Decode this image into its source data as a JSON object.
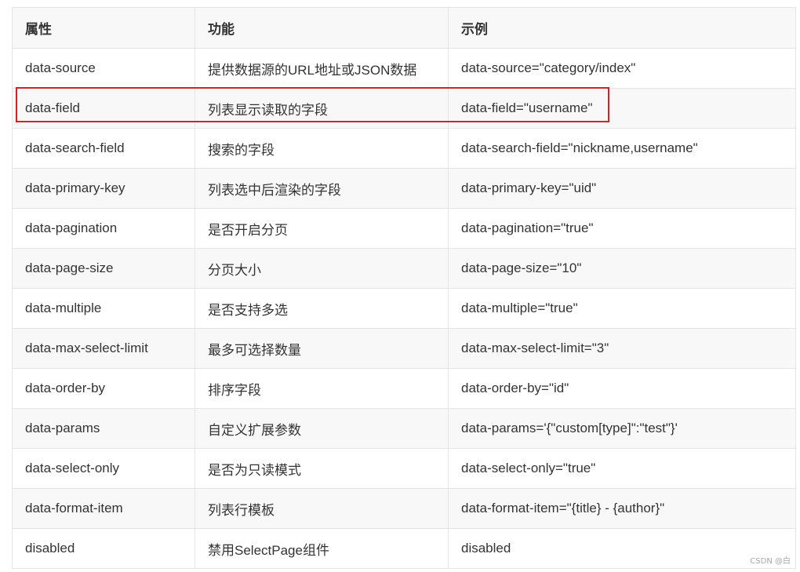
{
  "table": {
    "headers": [
      "属性",
      "功能",
      "示例"
    ],
    "rows": [
      [
        "data-source",
        "提供数据源的URL地址或JSON数据",
        "data-source=\"category/index\""
      ],
      [
        "data-field",
        "列表显示读取的字段",
        "data-field=\"username\""
      ],
      [
        "data-search-field",
        "搜索的字段",
        "data-search-field=\"nickname,username\""
      ],
      [
        "data-primary-key",
        "列表选中后渲染的字段",
        "data-primary-key=\"uid\""
      ],
      [
        "data-pagination",
        "是否开启分页",
        "data-pagination=\"true\""
      ],
      [
        "data-page-size",
        "分页大小",
        "data-page-size=\"10\""
      ],
      [
        "data-multiple",
        "是否支持多选",
        "data-multiple=\"true\""
      ],
      [
        "data-max-select-limit",
        "最多可选择数量",
        "data-max-select-limit=\"3\""
      ],
      [
        "data-order-by",
        "排序字段",
        "data-order-by=\"id\""
      ],
      [
        "data-params",
        "自定义扩展参数",
        "data-params='{\"custom[type]\":\"test\"}'"
      ],
      [
        "data-select-only",
        "是否为只读模式",
        "data-select-only=\"true\""
      ],
      [
        "data-format-item",
        "列表行模板",
        "data-format-item=\"{title} - {author}\""
      ],
      [
        "disabled",
        "禁用SelectPage组件",
        "disabled"
      ]
    ],
    "highlighted_row": "data-field"
  },
  "watermark": "CSDN @白",
  "colors": {
    "highlight_border": "#d2232a",
    "stripe": "#f8f8f8",
    "border": "#e5e5e5",
    "text": "#333333"
  }
}
